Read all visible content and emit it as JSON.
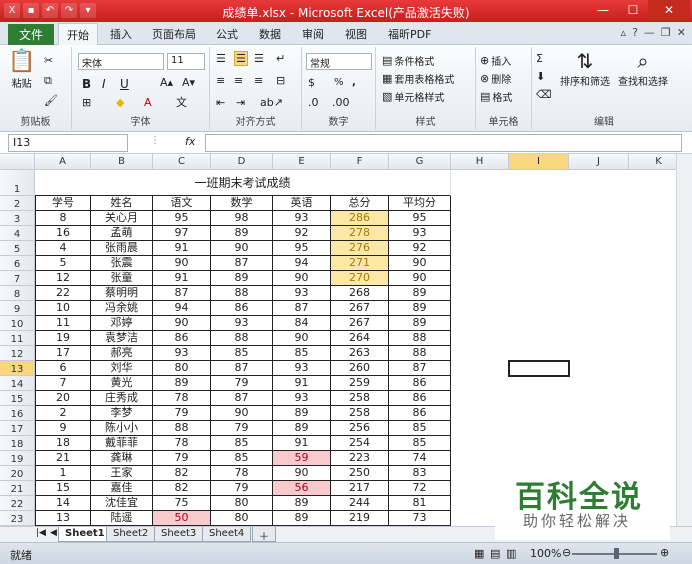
{
  "title": "成绩单.xlsx - Microsoft Excel(产品激活失败)",
  "tabs": {
    "file": "文件",
    "items": [
      "开始",
      "插入",
      "页面布局",
      "公式",
      "数据",
      "审阅",
      "视图",
      "福昕PDF"
    ],
    "active": 0
  },
  "ribbon": {
    "paste": "粘贴",
    "clipboard": "剪贴板",
    "font_name": "宋体",
    "font_size": "11",
    "font": "字体",
    "align": "对齐方式",
    "number_format": "常规",
    "number": "数字",
    "cond_format": "条件格式",
    "table_format": "套用表格格式",
    "cell_style": "单元格样式",
    "styles": "样式",
    "insert": "插入",
    "delete": "删除",
    "format": "格式",
    "cells": "单元格",
    "sort": "排序和筛选",
    "find": "查找和选择",
    "editing": "编辑",
    "bold": "B",
    "italic": "I",
    "underline": "U",
    "percent": "%",
    "comma": ","
  },
  "namebox": "I13",
  "fx": "fx",
  "columns": [
    "A",
    "B",
    "C",
    "D",
    "E",
    "F",
    "G",
    "H",
    "I",
    "J",
    "K"
  ],
  "selected_col": 8,
  "selected_row": 13,
  "sheet_title": "一班期末考试成绩",
  "headers": [
    "学号",
    "姓名",
    "语文",
    "数学",
    "英语",
    "总分",
    "平均分"
  ],
  "rows": [
    [
      "8",
      "关心月",
      "95",
      "98",
      "93",
      "286",
      "95"
    ],
    [
      "16",
      "孟萌",
      "97",
      "89",
      "92",
      "278",
      "93"
    ],
    [
      "4",
      "张雨晨",
      "91",
      "90",
      "95",
      "276",
      "92"
    ],
    [
      "5",
      "张震",
      "90",
      "87",
      "94",
      "271",
      "90"
    ],
    [
      "12",
      "张童",
      "91",
      "89",
      "90",
      "270",
      "90"
    ],
    [
      "22",
      "蔡明明",
      "87",
      "88",
      "93",
      "268",
      "89"
    ],
    [
      "10",
      "冯余姚",
      "94",
      "86",
      "87",
      "267",
      "89"
    ],
    [
      "11",
      "邓婷",
      "90",
      "93",
      "84",
      "267",
      "89"
    ],
    [
      "19",
      "袁梦洁",
      "86",
      "88",
      "90",
      "264",
      "88"
    ],
    [
      "17",
      "郝亮",
      "93",
      "85",
      "85",
      "263",
      "88"
    ],
    [
      "6",
      "刘华",
      "80",
      "87",
      "93",
      "260",
      "87"
    ],
    [
      "7",
      "黄光",
      "89",
      "79",
      "91",
      "259",
      "86"
    ],
    [
      "20",
      "庄秀成",
      "78",
      "87",
      "93",
      "258",
      "86"
    ],
    [
      "2",
      "李梦",
      "79",
      "90",
      "89",
      "258",
      "86"
    ],
    [
      "9",
      "陈小小",
      "88",
      "79",
      "89",
      "256",
      "85"
    ],
    [
      "18",
      "戴菲菲",
      "78",
      "85",
      "91",
      "254",
      "85"
    ],
    [
      "21",
      "龚琳",
      "79",
      "85",
      "59",
      "223",
      "74"
    ],
    [
      "1",
      "王家",
      "82",
      "78",
      "90",
      "250",
      "83"
    ],
    [
      "15",
      "嘉佳",
      "82",
      "79",
      "56",
      "217",
      "72"
    ],
    [
      "14",
      "沈佳宜",
      "75",
      "80",
      "89",
      "244",
      "81"
    ],
    [
      "13",
      "陆遥",
      "50",
      "80",
      "89",
      "219",
      "73"
    ]
  ],
  "highlight_yellow": [
    [
      0,
      5
    ],
    [
      1,
      5
    ],
    [
      2,
      5
    ],
    [
      3,
      5
    ],
    [
      4,
      5
    ]
  ],
  "highlight_red": [
    [
      16,
      4
    ],
    [
      18,
      4
    ],
    [
      20,
      2
    ]
  ],
  "sheets": [
    "Sheet1",
    "Sheet2",
    "Sheet3",
    "Sheet4"
  ],
  "status": "就绪",
  "zoom": "100%",
  "watermark": {
    "big": "百科全说",
    "small": "助你轻松解决"
  }
}
